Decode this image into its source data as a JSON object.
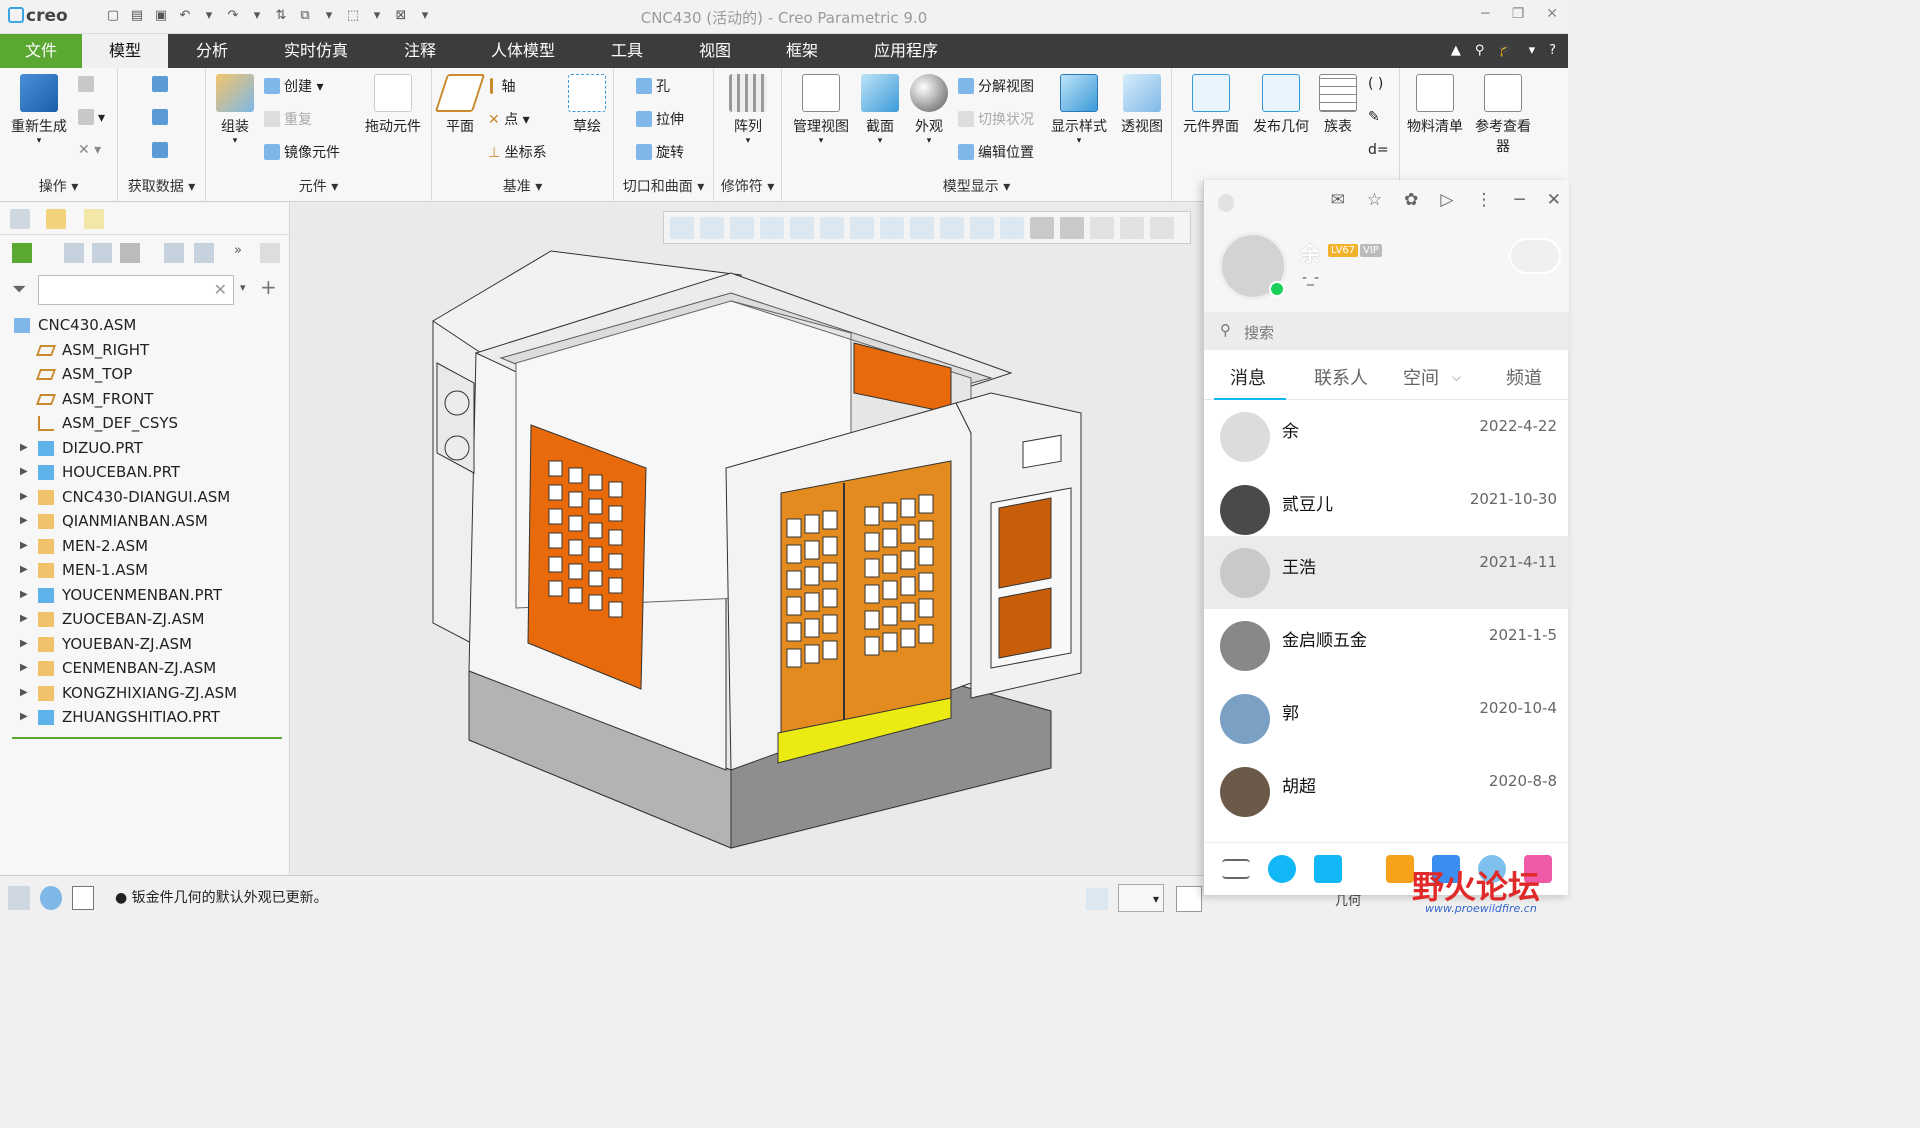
{
  "app": {
    "logo": "creo",
    "window_title": "CNC430 (活动的) - Creo Parametric 9.0"
  },
  "menu": {
    "file": "文件",
    "tabs": [
      "模型",
      "分析",
      "实时仿真",
      "注释",
      "人体模型",
      "工具",
      "视图",
      "框架",
      "应用程序"
    ]
  },
  "ribbon": {
    "operations": {
      "regenerate": "重新生成",
      "group": "操作"
    },
    "get_data": {
      "group": "获取数据"
    },
    "component": {
      "assemble": "组装",
      "create": "创建",
      "repeat": "重复",
      "mirror": "镜像元件",
      "drag": "拖动元件",
      "group": "元件"
    },
    "datum": {
      "plane": "平面",
      "axis": "轴",
      "point": "点",
      "csys": "坐标系",
      "sketch": "草绘",
      "group": "基准"
    },
    "cut_surface": {
      "hole": "孔",
      "extrude": "拉伸",
      "revolve": "旋转",
      "group": "切口和曲面"
    },
    "modifiers": {
      "pattern": "阵列",
      "group": "修饰符"
    },
    "model_display": {
      "manage_views": "管理视图",
      "section": "截面",
      "appearance": "外观",
      "explode_view": "分解视图",
      "toggle_status": "切换状况",
      "edit_position": "编辑位置",
      "display_style": "显示样式",
      "perspective": "透视图",
      "group": "模型显示"
    },
    "extra": {
      "component_interface": "元件界面",
      "publish_geometry": "发布几何",
      "family_table": "族表",
      "bom": "物料清单",
      "reference_viewer": "参考查看器"
    }
  },
  "model_tree": {
    "root": "CNC430.ASM",
    "items": [
      {
        "label": "ASM_RIGHT",
        "kind": "plane"
      },
      {
        "label": "ASM_TOP",
        "kind": "plane"
      },
      {
        "label": "ASM_FRONT",
        "kind": "plane"
      },
      {
        "label": "ASM_DEF_CSYS",
        "kind": "csys"
      },
      {
        "label": "DIZUO.PRT",
        "kind": "part"
      },
      {
        "label": "HOUCEBAN.PRT",
        "kind": "part"
      },
      {
        "label": "CNC430-DIANGUI.ASM",
        "kind": "asm"
      },
      {
        "label": "QIANMIANBAN.ASM",
        "kind": "asm"
      },
      {
        "label": "MEN-2.ASM",
        "kind": "asm"
      },
      {
        "label": "MEN-1.ASM",
        "kind": "asm"
      },
      {
        "label": "YOUCENMENBAN.PRT",
        "kind": "part"
      },
      {
        "label": "ZUOCEBAN-ZJ.ASM",
        "kind": "asm"
      },
      {
        "label": "YOUEBAN-ZJ.ASM",
        "kind": "asm"
      },
      {
        "label": "CENMENBAN-ZJ.ASM",
        "kind": "asm"
      },
      {
        "label": "KONGZHIXIANG-ZJ.ASM",
        "kind": "asm"
      },
      {
        "label": "ZHUANGSHITIAO.PRT",
        "kind": "part"
      }
    ]
  },
  "status": {
    "message": "钣金件几何的默认外观已更新。",
    "filter_value": "几何"
  },
  "qq": {
    "name": "余",
    "level": "LV67",
    "vip": "VIP",
    "signature": "-_-",
    "search_placeholder": "搜索",
    "tabs": [
      "消息",
      "联系人",
      "空间",
      "频道"
    ],
    "contacts": [
      {
        "name": "余",
        "date": "2022-4-22"
      },
      {
        "name": "贰豆儿",
        "date": "2021-10-30"
      },
      {
        "name": "王浩",
        "date": "2021-4-11"
      },
      {
        "name": "金启顺五金",
        "date": "2021-1-5"
      },
      {
        "name": "郭",
        "date": "2020-10-4"
      },
      {
        "name": "胡超",
        "date": "2020-8-8"
      }
    ]
  },
  "watermark": {
    "text": "野火论坛",
    "url": "www.proewildfire.cn"
  },
  "colors": {
    "menu_bar": "#3c3c3c",
    "file_tab": "#5aa832",
    "door_orange": "#e86a0a",
    "door_wood": "#e38b1f",
    "strip_yellow": "#ebea12",
    "qq_accent": "#12b7f5"
  }
}
